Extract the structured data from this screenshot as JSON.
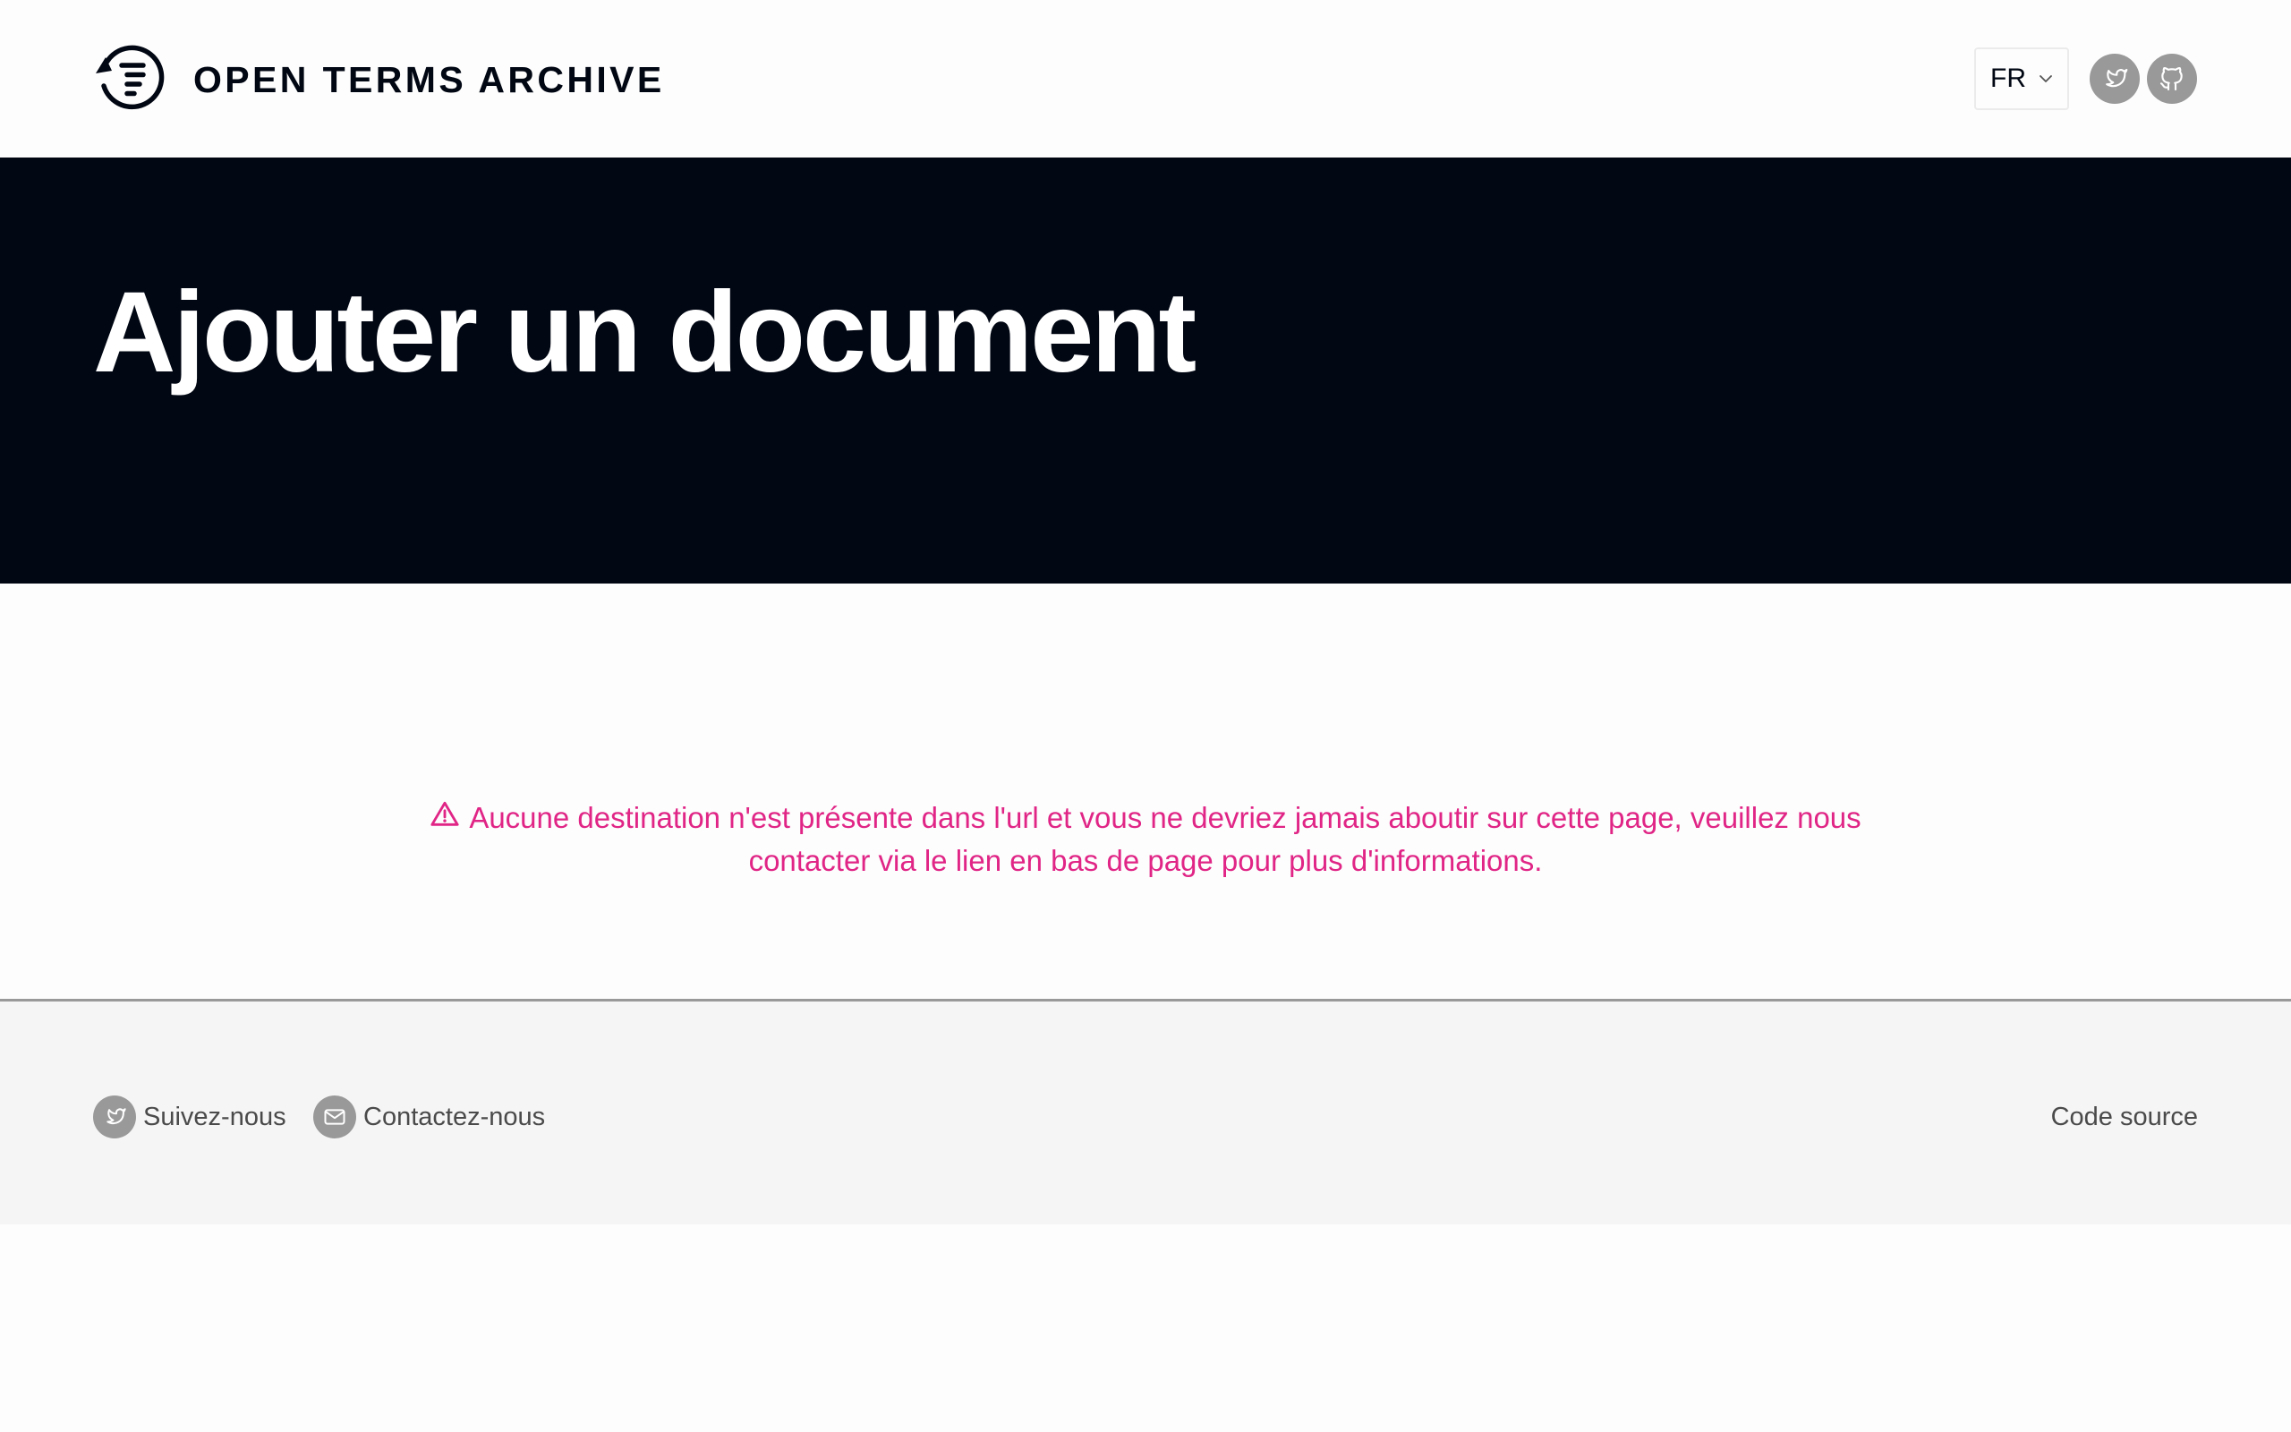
{
  "header": {
    "logo_text": "OPEN TERMS ARCHIVE",
    "logo_icon": "open-terms-archive-logo-icon",
    "language": {
      "selected": "FR"
    },
    "social": [
      {
        "name": "twitter",
        "icon": "twitter-icon"
      },
      {
        "name": "github",
        "icon": "github-icon"
      }
    ]
  },
  "hero": {
    "title": "Ajouter un document"
  },
  "main": {
    "alert": {
      "icon": "warning-triangle-icon",
      "text": "Aucune destination n'est présente dans l'url et vous ne devriez jamais aboutir sur cette page, veuillez nous contacter via le lien en bas de page pour plus d'informations."
    }
  },
  "footer": {
    "follow_label": "Suivez-nous",
    "contact_label": "Contactez-nous",
    "source_label": "Code source"
  },
  "colors": {
    "hero_background": "#010713",
    "alert_text": "#e02586",
    "icon_background": "#999999",
    "footer_background": "#f5f5f6"
  }
}
